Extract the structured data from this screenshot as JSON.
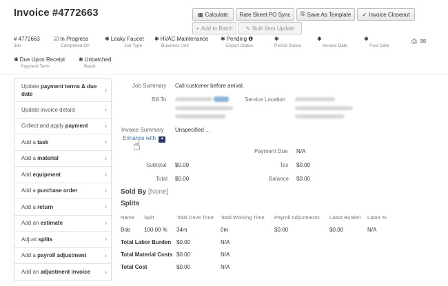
{
  "header": {
    "title": "Invoice #4772663"
  },
  "toolbar": {
    "calculate": "Calculate",
    "rate_sheet": "Rate Sheet PO Sync",
    "save_template": "Save As Template",
    "closeout": "Invoice Closeout",
    "add_batch": "Add to Batch",
    "bulk_update": "Bulk Item Update"
  },
  "meta": {
    "job": {
      "value": "# 4772663",
      "label": "Job"
    },
    "completed": {
      "value": "In Progress",
      "label": "Completed On"
    },
    "job_type": {
      "value": "Leaky Faucet",
      "label": "Job Type"
    },
    "business_unit": {
      "value": "HVAC Maintenance",
      "label": "Business Unit"
    },
    "export": {
      "value": "Pending",
      "label": "Export Status"
    },
    "period": {
      "label": "Period Status"
    },
    "invoice_date": {
      "label": "Invoice Date"
    },
    "post_date": {
      "label": "Post Date"
    },
    "payment_term": {
      "value": "Due Upon Receipt",
      "label": "Payment Term"
    },
    "batch": {
      "value": "Unbatched",
      "label": "Batch"
    }
  },
  "sidebar": {
    "items": [
      {
        "pre": "Update ",
        "bold": "payment terms & due date",
        "post": ""
      },
      {
        "pre": "Update ",
        "bold": "invoice details",
        "post": ""
      },
      {
        "pre": "Collect and apply ",
        "bold": "payment",
        "post": ""
      },
      {
        "pre": "Add a ",
        "bold": "task",
        "post": ""
      },
      {
        "pre": "Add a ",
        "bold": "material",
        "post": ""
      },
      {
        "pre": "Add ",
        "bold": "equipment",
        "post": ""
      },
      {
        "pre": "Add a ",
        "bold": "purchase order",
        "post": ""
      },
      {
        "pre": "Add a ",
        "bold": "return",
        "post": ""
      },
      {
        "pre": "Add an ",
        "bold": "estimate",
        "post": ""
      },
      {
        "pre": "Adjust ",
        "bold": "splits",
        "post": ""
      },
      {
        "pre": "Add a ",
        "bold": "payroll adjustment",
        "post": ""
      },
      {
        "pre": "Add an ",
        "bold": "adjustment invoice",
        "post": ""
      }
    ]
  },
  "main": {
    "job_summary_label": "Job Summary",
    "job_summary_value": "Call customer before arrival.",
    "bill_to_label": "Bill To",
    "service_location_label": "Service Location",
    "invoice_summary_label": "Invoice Summary",
    "invoice_summary_value": "Unspecified ...",
    "enhance_with": "Enhance with",
    "payment_due_label": "Payment Due",
    "payment_due_value": "N/A",
    "subtotal_label": "Subtotal",
    "subtotal_value": "$0.00",
    "tax_label": "Tax",
    "tax_value": "$0.00",
    "total_label": "Total",
    "total_value": "$0.00",
    "balance_label": "Balance",
    "balance_value": "$0.00",
    "sold_by_label": "Sold By",
    "sold_by_value": "[None]",
    "splits_title": "Splits"
  },
  "splits": {
    "headers": [
      "Name",
      "Split",
      "Total Drive Time",
      "Total Working Time",
      "Payroll Adjustments",
      "Labor Burden",
      "Labor %"
    ],
    "row": [
      "Bob",
      "100.00 %",
      "34m",
      "0m",
      "$0.00",
      "$0.00",
      "N/A"
    ],
    "totals": [
      {
        "label": "Total Labor Burden",
        "value": "$0.00",
        "extra": "N/A"
      },
      {
        "label": "Total Material Costs",
        "value": "$0.00",
        "extra": "N/A"
      },
      {
        "label": "Total Cost",
        "value": "$0.00",
        "extra": "N/A"
      }
    ]
  }
}
